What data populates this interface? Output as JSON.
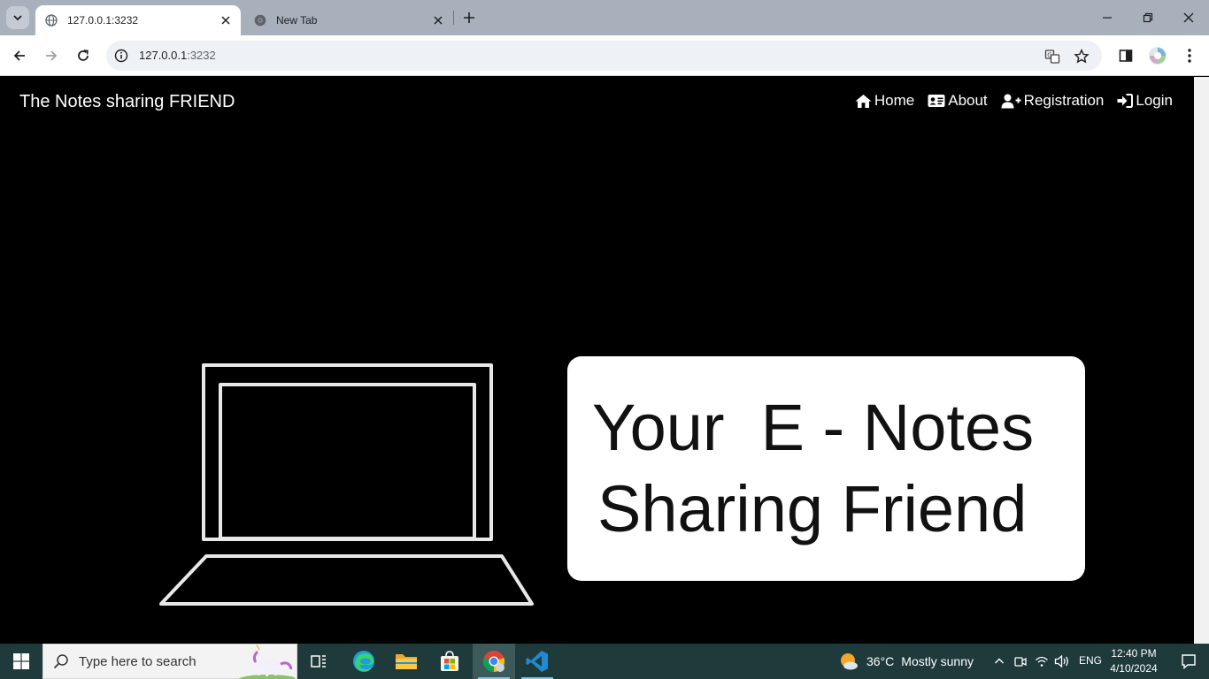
{
  "browser": {
    "tabs": [
      {
        "title": "127.0.0.1:3232",
        "active": true
      },
      {
        "title": "New Tab",
        "active": false
      }
    ],
    "address": {
      "host": "127.0.0.1",
      "port": ":3232"
    }
  },
  "page": {
    "brand": "The Notes sharing FRIEND",
    "nav": [
      {
        "label": "Home",
        "icon": "home-icon"
      },
      {
        "label": "About",
        "icon": "id-card-icon"
      },
      {
        "label": "Registration",
        "icon": "user-plus-icon"
      },
      {
        "label": "Login",
        "icon": "sign-in-icon"
      }
    ],
    "hero": {
      "line1": "Your  E - Notes",
      "line2": "Sharing Friend"
    }
  },
  "taskbar": {
    "search_placeholder": "Type here to search",
    "weather": {
      "temp": "36°C",
      "condition": "Mostly sunny"
    },
    "language": "ENG",
    "time": "12:40 PM",
    "date": "4/10/2024",
    "pinned_apps": [
      "task-view-icon",
      "edge-icon",
      "file-explorer-icon",
      "store-icon",
      "chrome-icon",
      "vscode-icon"
    ]
  },
  "colors": {
    "page_background": "#000000",
    "taskbar": "#1f3a3b",
    "tabstrip": "#a8b0bc"
  }
}
